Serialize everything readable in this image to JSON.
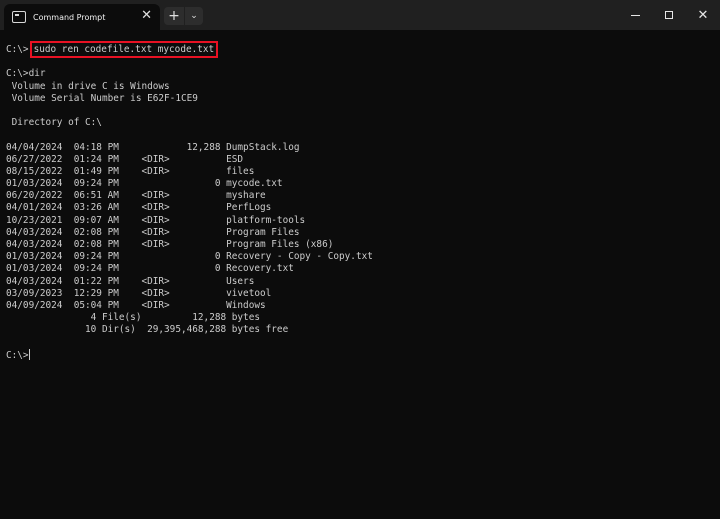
{
  "window": {
    "tab_title": "Command Prompt",
    "tab_close": "✕",
    "new_tab": "+",
    "dropdown": "⌄",
    "close": "✕"
  },
  "terminal": {
    "prompt": "C:\\>",
    "command": "sudo ren codefile.txt mycode.txt",
    "dir_cmd": "C:\\>dir",
    "volume": " Volume in drive C is Windows",
    "serial": " Volume Serial Number is E62F-1CE9",
    "directory": " Directory of C:\\",
    "entries": [
      "04/04/2024  04:18 PM            12,288 DumpStack.log",
      "06/27/2022  01:24 PM    <DIR>          ESD",
      "08/15/2022  01:49 PM    <DIR>          files",
      "01/03/2024  09:24 PM                 0 mycode.txt",
      "06/20/2022  06:51 AM    <DIR>          myshare",
      "04/01/2024  03:26 AM    <DIR>          PerfLogs",
      "10/23/2021  09:07 AM    <DIR>          platform-tools",
      "04/03/2024  02:08 PM    <DIR>          Program Files",
      "04/03/2024  02:08 PM    <DIR>          Program Files (x86)",
      "01/03/2024  09:24 PM                 0 Recovery - Copy - Copy.txt",
      "01/03/2024  09:24 PM                 0 Recovery.txt",
      "04/03/2024  01:22 PM    <DIR>          Users",
      "03/09/2023  12:29 PM    <DIR>          vivetool",
      "04/09/2024  05:04 PM    <DIR>          Windows"
    ],
    "files_summary": "               4 File(s)         12,288 bytes",
    "dirs_summary": "              10 Dir(s)  29,395,468,288 bytes free",
    "final_prompt": "C:\\>"
  }
}
